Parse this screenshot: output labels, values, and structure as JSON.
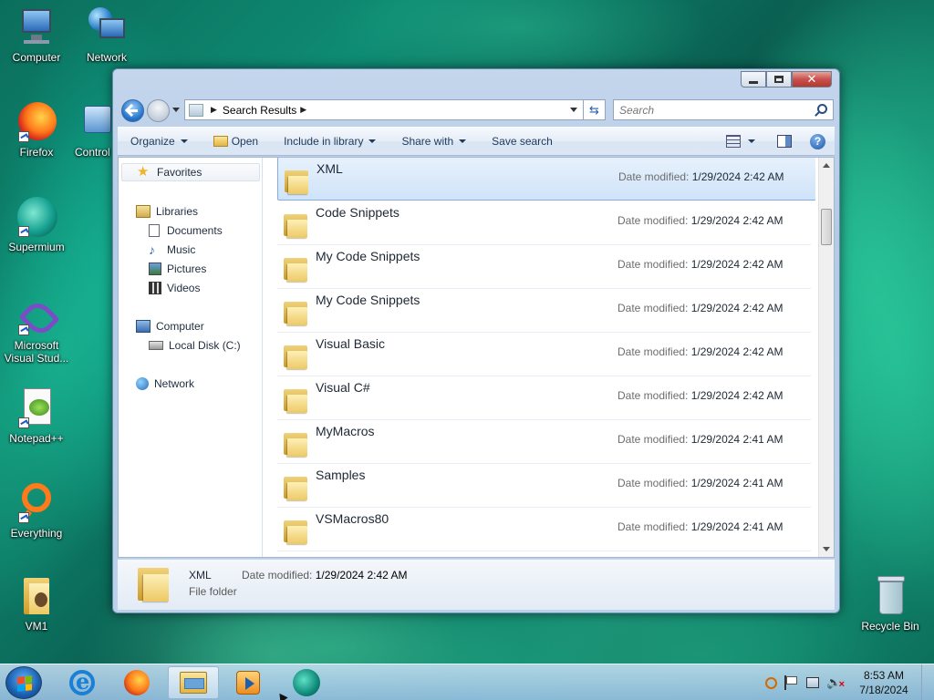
{
  "desktop": {
    "icons": [
      {
        "label": "Computer",
        "icon": "computer-icon"
      },
      {
        "label": "Network",
        "icon": "network-icon"
      },
      {
        "label": "Firefox",
        "icon": "firefox-icon"
      },
      {
        "label": "Control",
        "icon": "control-panel-icon"
      },
      {
        "label": "Supermium",
        "icon": "supermium-icon"
      },
      {
        "label": "Microsoft Visual Stud...",
        "icon": "visual-studio-icon"
      },
      {
        "label": "Notepad++",
        "icon": "notepad-plus-plus-icon"
      },
      {
        "label": "Everything",
        "icon": "everything-icon"
      },
      {
        "label": "VM1",
        "icon": "folder-icon"
      },
      {
        "label": "Recycle Bin",
        "icon": "recycle-bin-icon"
      }
    ]
  },
  "window": {
    "address": {
      "path": [
        "Search Results"
      ]
    },
    "search": {
      "placeholder": "Search"
    },
    "commands": {
      "organize": "Organize",
      "open": "Open",
      "include_in_library": "Include in library",
      "share_with": "Share with",
      "save_search": "Save search"
    },
    "nav": {
      "favorites": "Favorites",
      "libraries": "Libraries",
      "documents": "Documents",
      "music": "Music",
      "pictures": "Pictures",
      "videos": "Videos",
      "computer": "Computer",
      "local_disk": "Local Disk (C:)",
      "network": "Network"
    },
    "files": {
      "date_label": "Date modified:",
      "items": [
        {
          "name": "XML",
          "date": "1/29/2024 2:42 AM",
          "selected": true
        },
        {
          "name": "Code Snippets",
          "date": "1/29/2024 2:42 AM"
        },
        {
          "name": "My Code Snippets",
          "date": "1/29/2024 2:42 AM"
        },
        {
          "name": "My Code Snippets",
          "date": "1/29/2024 2:42 AM"
        },
        {
          "name": "Visual Basic",
          "date": "1/29/2024 2:42 AM"
        },
        {
          "name": "Visual C#",
          "date": "1/29/2024 2:42 AM"
        },
        {
          "name": "MyMacros",
          "date": "1/29/2024 2:41 AM"
        },
        {
          "name": "Samples",
          "date": "1/29/2024 2:41 AM"
        },
        {
          "name": "VSMacros80",
          "date": "1/29/2024 2:41 AM"
        }
      ]
    },
    "details": {
      "name": "XML",
      "date_label": "Date modified:",
      "date": "1/29/2024 2:42 AM",
      "type": "File folder"
    }
  },
  "taskbar": {
    "clock_time": "8:53 AM",
    "clock_date": "7/18/2024"
  }
}
